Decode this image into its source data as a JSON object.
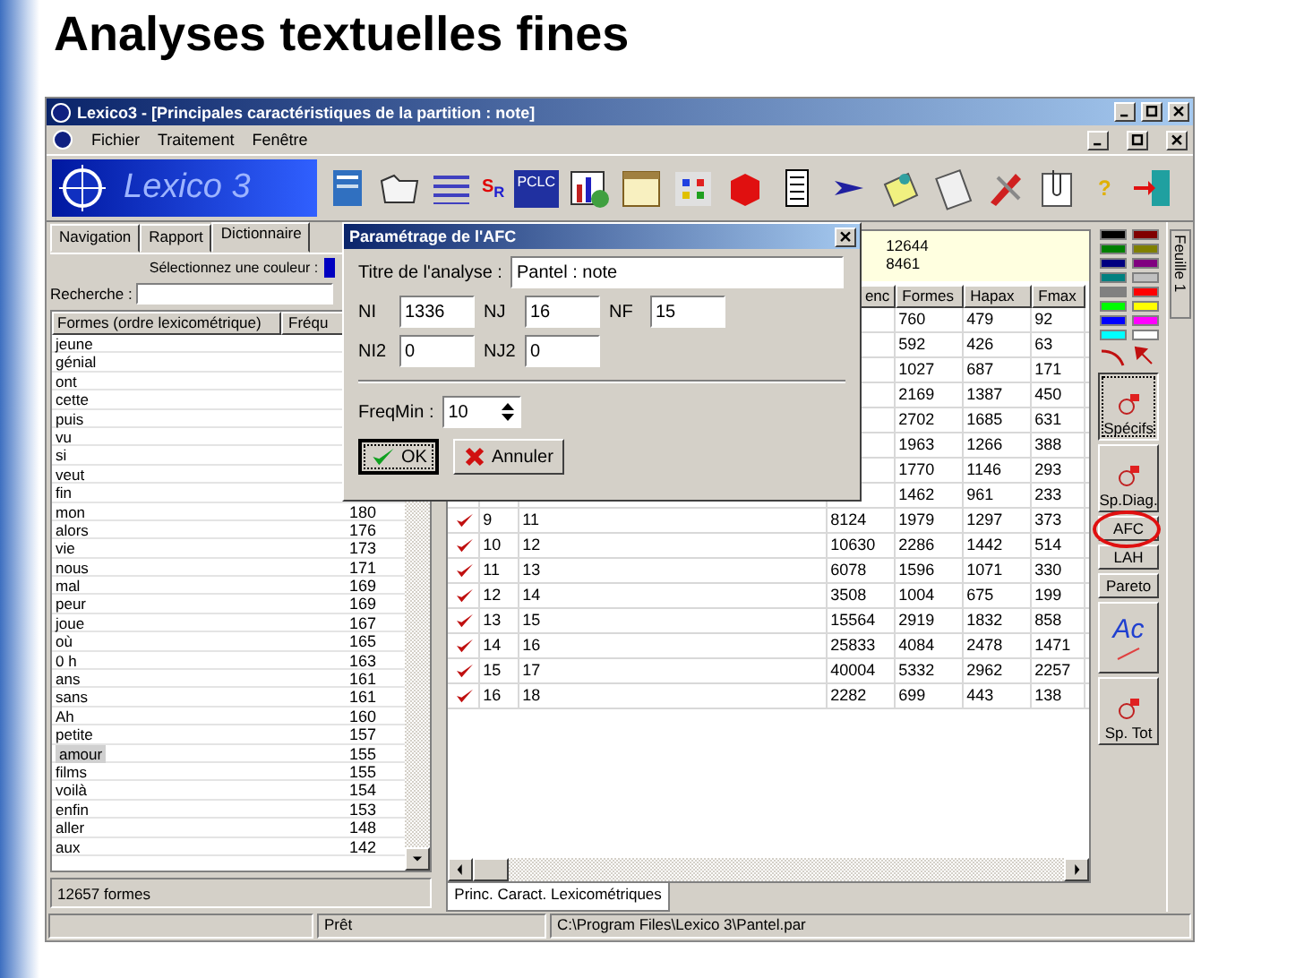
{
  "slide": {
    "title": "Analyses textuelles fines"
  },
  "window": {
    "title": "Lexico3 - [Principales caractéristiques de la partition : note]"
  },
  "menu": [
    "Fichier",
    "Traitement",
    "Fenêtre"
  ],
  "toolbar": {
    "logo": "Lexico 3",
    "sr_button": "S$_{R}$",
    "pclc_button": "PCLC",
    "help_button": "?"
  },
  "left_panel": {
    "tabs": [
      {
        "label": "Navigation",
        "selected": false
      },
      {
        "label": "Rapport",
        "selected": false
      },
      {
        "label": "Dictionnaire",
        "selected": true
      }
    ],
    "color_label": "Sélectionnez une couleur :",
    "color_swatch": {
      "color": "#0000c0"
    },
    "search_label": "Recherche :",
    "columns": [
      "Formes (ordre lexicométrique)",
      "Fréqu"
    ],
    "rows": [
      {
        "form": "jeune",
        "selected": false
      },
      {
        "form": "génial",
        "selected": false
      },
      {
        "form": "ont",
        "selected": false
      },
      {
        "form": "cette",
        "selected": false
      },
      {
        "form": "puis",
        "selected": false
      },
      {
        "form": "vu",
        "selected": false
      },
      {
        "form": "si",
        "selected": false
      },
      {
        "form": "veut",
        "selected": false
      },
      {
        "form": "fin",
        "selected": false
      },
      {
        "form": "mon",
        "freq": "180",
        "selected": false
      },
      {
        "form": "alors",
        "freq": "176",
        "selected": false
      },
      {
        "form": "vie",
        "freq": "173",
        "selected": false
      },
      {
        "form": "nous",
        "freq": "171",
        "selected": false
      },
      {
        "form": "mal",
        "freq": "169",
        "selected": false
      },
      {
        "form": "peur",
        "freq": "169",
        "selected": false
      },
      {
        "form": "joue",
        "freq": "167",
        "selected": false
      },
      {
        "form": "où",
        "freq": "165",
        "selected": false
      },
      {
        "form": "0 h",
        "freq": "163",
        "selected": false
      },
      {
        "form": "ans",
        "freq": "161",
        "selected": false
      },
      {
        "form": "sans",
        "freq": "161",
        "selected": false
      },
      {
        "form": "Ah",
        "freq": "160",
        "selected": false
      },
      {
        "form": "petite",
        "freq": "157",
        "selected": false
      },
      {
        "form": "amour",
        "freq": "155",
        "selected": true
      },
      {
        "form": "films",
        "freq": "155",
        "selected": false
      },
      {
        "form": "voilà",
        "freq": "154",
        "selected": false
      },
      {
        "form": "enfin",
        "freq": "153",
        "selected": false
      },
      {
        "form": "aller",
        "freq": "148",
        "selected": false
      },
      {
        "form": "aux",
        "freq": "142",
        "selected": false
      }
    ],
    "footer": "12657 formes"
  },
  "summary": [
    "12644",
    "8461"
  ],
  "table": {
    "columns": [
      "enc",
      "Formes",
      "Hapax",
      "Fmax"
    ],
    "rows": [
      {
        "formes": "760",
        "hapax": "479",
        "fmax": "92"
      },
      {
        "formes": "592",
        "hapax": "426",
        "fmax": "63"
      },
      {
        "formes": "1027",
        "hapax": "687",
        "fmax": "171"
      },
      {
        "formes": "2169",
        "hapax": "1387",
        "fmax": "450"
      },
      {
        "formes": "2702",
        "hapax": "1685",
        "fmax": "631"
      },
      {
        "formes": "1963",
        "hapax": "1266",
        "fmax": "388"
      },
      {
        "formes": "1770",
        "hapax": "1146",
        "fmax": "293"
      },
      {
        "formes": "1462",
        "hapax": "961",
        "fmax": "233"
      },
      {
        "checked": true,
        "num": "9",
        "part": "11",
        "occ": "8124",
        "formes": "1979",
        "hapax": "1297",
        "fmax": "373"
      },
      {
        "checked": true,
        "num": "10",
        "part": "12",
        "occ": "10630",
        "formes": "2286",
        "hapax": "1442",
        "fmax": "514"
      },
      {
        "checked": true,
        "num": "11",
        "part": "13",
        "occ": "6078",
        "formes": "1596",
        "hapax": "1071",
        "fmax": "330"
      },
      {
        "checked": true,
        "num": "12",
        "part": "14",
        "occ": "3508",
        "formes": "1004",
        "hapax": "675",
        "fmax": "199"
      },
      {
        "checked": true,
        "num": "13",
        "part": "15",
        "occ": "15564",
        "formes": "2919",
        "hapax": "1832",
        "fmax": "858"
      },
      {
        "checked": true,
        "num": "14",
        "part": "16",
        "occ": "25833",
        "formes": "4084",
        "hapax": "2478",
        "fmax": "1471"
      },
      {
        "checked": true,
        "num": "15",
        "part": "17",
        "occ": "40004",
        "formes": "5332",
        "hapax": "2962",
        "fmax": "2257"
      },
      {
        "checked": true,
        "num": "16",
        "part": "18",
        "occ": "2282",
        "formes": "699",
        "hapax": "443",
        "fmax": "138"
      }
    ]
  },
  "bottom_tab": "Princ. Caract. Lexicométriques",
  "palette": [
    {
      "color": "#000000"
    },
    {
      "color": "#800000"
    },
    {
      "color": "#008000"
    },
    {
      "color": "#808000"
    },
    {
      "color": "#000080"
    },
    {
      "color": "#800080"
    },
    {
      "color": "#008080"
    },
    {
      "color": "#c0c0c0"
    },
    {
      "color": "#808080"
    },
    {
      "color": "#ff0000"
    },
    {
      "color": "#00ff00"
    },
    {
      "color": "#ffff00"
    },
    {
      "color": "#0000ff"
    },
    {
      "color": "#ff00ff"
    },
    {
      "color": "#00ffff"
    },
    {
      "color": "#ffffff"
    }
  ],
  "tools": [
    {
      "kind": "icon_label",
      "label": "Spécifs",
      "selected": true
    },
    {
      "kind": "icon_label",
      "label": "Sp.Diag.",
      "selected": false
    },
    {
      "kind": "label",
      "label": "AFC",
      "selected": false
    },
    {
      "kind": "label",
      "label": "LAH",
      "selected": false
    },
    {
      "kind": "label",
      "label": "Pareto",
      "selected": false
    },
    {
      "kind": "glyph",
      "label": "Ac",
      "selected": false
    },
    {
      "kind": "icon_label",
      "label": "Sp. Tot",
      "selected": false
    }
  ],
  "side_tab": "Feuille 1",
  "status": [
    "Prêt",
    "C:\\Program Files\\Lexico 3\\Pantel.par"
  ],
  "dialog": {
    "title": "Paramétrage de l'AFC",
    "name_label": "Titre de l'analyse :",
    "name_value": "Pantel : note",
    "fields": [
      [
        {
          "label": "NI",
          "value": "1336"
        },
        {
          "label": "NJ",
          "value": "16"
        },
        {
          "label": "NF",
          "value": "15"
        }
      ],
      [
        {
          "label": "NI2",
          "value": "0"
        },
        {
          "label": "NJ2",
          "value": "0"
        }
      ]
    ],
    "freq_label": "FreqMin :",
    "freq_value": "10",
    "buttons": [
      {
        "kind": "ok",
        "label": "OK",
        "focused": true
      },
      {
        "kind": "cancel",
        "label": "Annuler",
        "focused": false
      }
    ]
  }
}
